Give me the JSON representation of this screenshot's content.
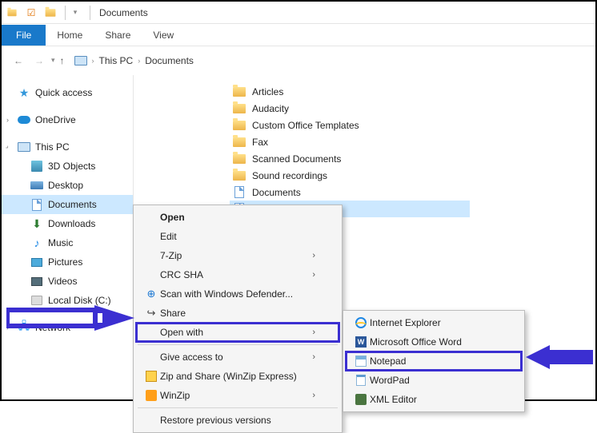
{
  "window": {
    "title": "Documents"
  },
  "ribbon": {
    "file": "File",
    "home": "Home",
    "share": "Share",
    "view": "View"
  },
  "breadcrumb": {
    "root": "This PC",
    "current": "Documents"
  },
  "sidebar": {
    "quick_access": "Quick access",
    "onedrive": "OneDrive",
    "this_pc": "This PC",
    "items": [
      {
        "label": "3D Objects"
      },
      {
        "label": "Desktop"
      },
      {
        "label": "Documents"
      },
      {
        "label": "Downloads"
      },
      {
        "label": "Music"
      },
      {
        "label": "Pictures"
      },
      {
        "label": "Videos"
      },
      {
        "label": "Local Disk (C:)"
      }
    ],
    "network": "Network"
  },
  "files": [
    {
      "label": "Articles"
    },
    {
      "label": "Audacity"
    },
    {
      "label": "Custom Office Templates"
    },
    {
      "label": "Fax"
    },
    {
      "label": "Scanned Documents"
    },
    {
      "label": "Sound recordings"
    },
    {
      "label": "Documents"
    }
  ],
  "ctx": {
    "open": "Open",
    "edit": "Edit",
    "seven_zip": "7-Zip",
    "crc": "CRC SHA",
    "defender": "Scan with Windows Defender...",
    "share": "Share",
    "open_with": "Open with",
    "give_access": "Give access to",
    "zip_share": "Zip and Share (WinZip Express)",
    "winzip": "WinZip",
    "restore": "Restore previous versions"
  },
  "submenu": {
    "ie": "Internet Explorer",
    "word": "Microsoft Office Word",
    "notepad": "Notepad",
    "wordpad": "WordPad",
    "xml": "XML Editor"
  }
}
